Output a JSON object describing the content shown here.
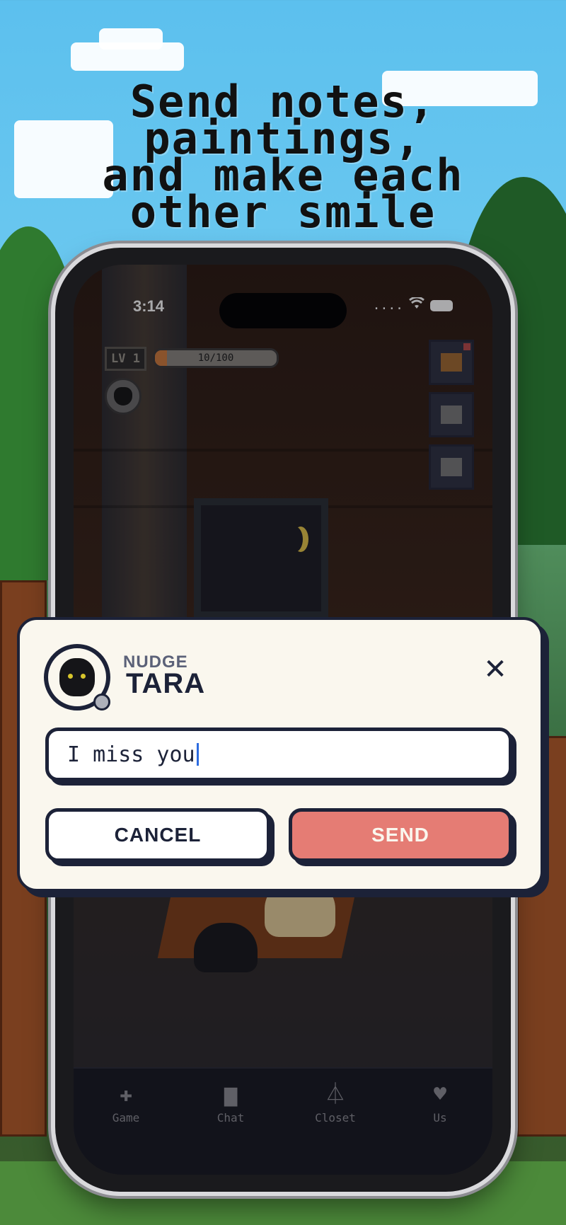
{
  "promo": {
    "headline": "Send notes,\npaintings,\nand make each\nother smile"
  },
  "status_bar": {
    "time": "3:14",
    "signal": "....",
    "wifi_icon": "wifi-icon",
    "battery_icon": "battery-icon"
  },
  "hud": {
    "level": "LV 1",
    "xp": "10/100",
    "xp_fraction": 0.1
  },
  "modal": {
    "label": "NUDGE",
    "name": "TARA",
    "close": "✕",
    "message_value": "I miss you",
    "cancel_label": "CANCEL",
    "send_label": "SEND"
  },
  "tabs": [
    {
      "label": "Game",
      "icon": "✚"
    },
    {
      "label": "Chat",
      "icon": "▆"
    },
    {
      "label": "Closet",
      "icon": "⏃"
    },
    {
      "label": "Us",
      "icon": "♥"
    }
  ],
  "colors": {
    "send_button": "#e57c74",
    "ink": "#1c2238",
    "modal_bg": "#faf7ee"
  }
}
